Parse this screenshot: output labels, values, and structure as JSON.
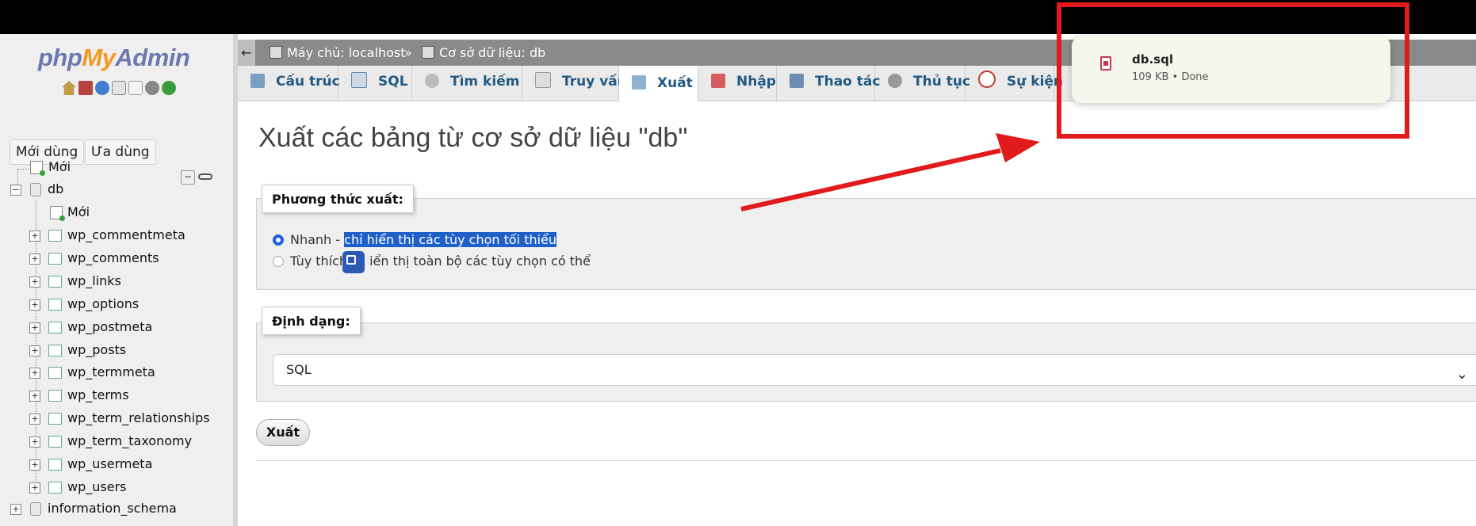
{
  "logo": {
    "part1": "php",
    "part2": "My",
    "part3": "Admin"
  },
  "sidebar": {
    "btn_recent": "Mới dùng",
    "btn_favorite": "Ưa dùng",
    "tree": {
      "new": "Mới",
      "db": "db",
      "db_new": "Mới",
      "tables": [
        "wp_commentmeta",
        "wp_comments",
        "wp_links",
        "wp_options",
        "wp_postmeta",
        "wp_posts",
        "wp_termmeta",
        "wp_terms",
        "wp_term_relationships",
        "wp_term_taxonomy",
        "wp_usermeta",
        "wp_users"
      ],
      "information_schema": "information_schema"
    }
  },
  "breadcrumb": {
    "back": "←",
    "server": "Máy chủ: localhost",
    "sep": "»",
    "database": "Cơ sở dữ liệu: db"
  },
  "tabs": [
    "Cấu trúc",
    "SQL",
    "Tìm kiếm",
    "Truy vấn",
    "Xuất",
    "Nhập",
    "Thao tác",
    "Thủ tục",
    "Sự kiện"
  ],
  "active_tab": "Xuất",
  "main": {
    "title": "Xuất các bảng từ cơ sở dữ liệu \"db\"",
    "method_legend": "Phương thức xuất:",
    "quick_prefix": "Nhanh - ",
    "quick_highlight": "chỉ hiển thị các tùy chọn tối thiểu",
    "custom_prefix": "Tùy thích",
    "custom_rest": "iển thị toàn bộ các tùy chọn có thể",
    "format_legend": "Định dạng:",
    "format_value": "SQL",
    "submit": "Xuất"
  },
  "download": {
    "filename": "db.sql",
    "status": "109 KB • Done"
  },
  "colors": {
    "accent": "#235a81",
    "highlight": "#1f5fc8",
    "annotation": "#e11b1b"
  }
}
